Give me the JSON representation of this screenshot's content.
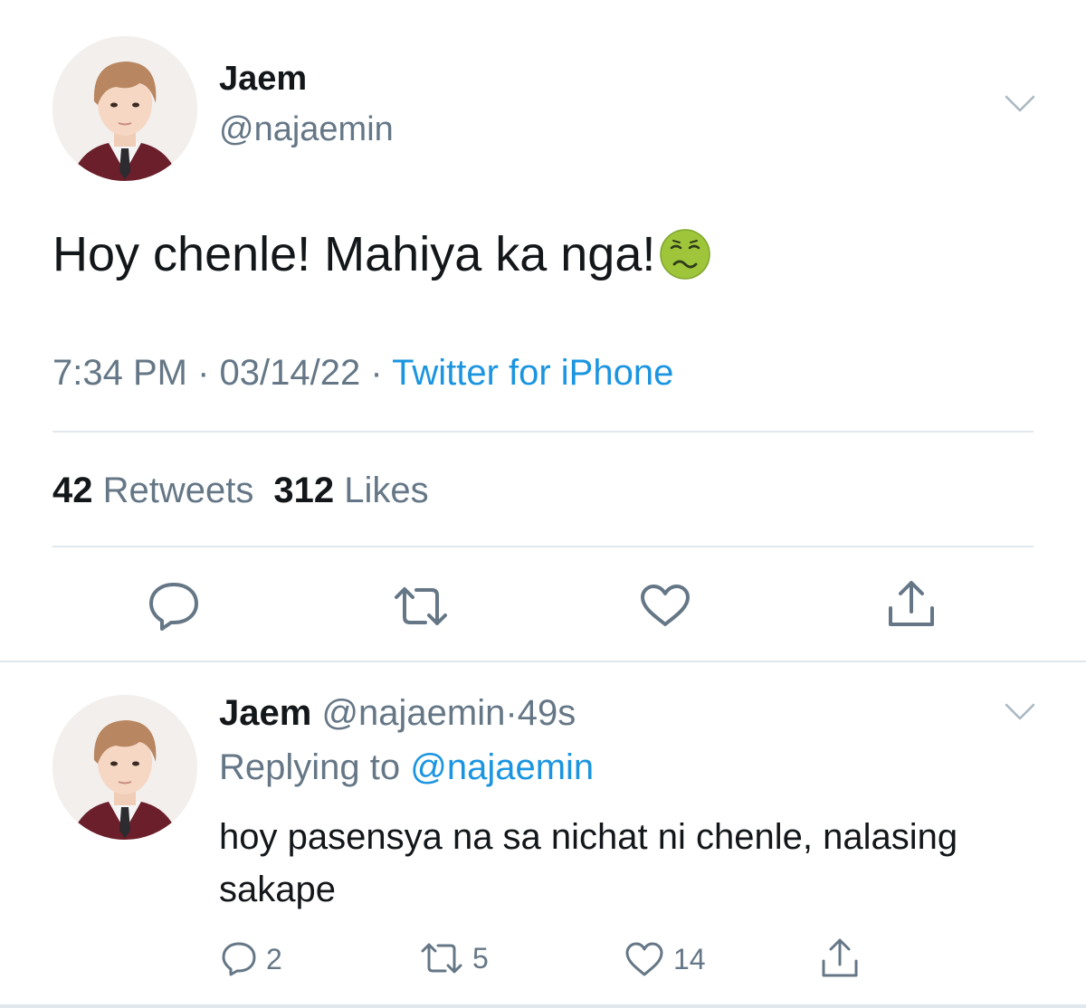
{
  "main_tweet": {
    "author_name": "Jaem",
    "author_handle": "@najaemin",
    "text": "Hoy chenle! Mahiya ka nga!",
    "emoji": "nauseated-face",
    "time": "7:34 PM",
    "date": "03/14/22",
    "separator": "·",
    "source": "Twitter for iPhone",
    "retweet_count": "42",
    "retweet_label": "Retweets",
    "like_count": "312",
    "like_label": "Likes"
  },
  "reply_tweet": {
    "author_name": "Jaem",
    "author_handle": "@najaemin",
    "separator": "·",
    "elapsed": "49s",
    "replying_label": "Replying to",
    "replying_handle": "@najaemin",
    "text": "hoy pasensya na sa nichat ni chenle, nalasing sakape",
    "reply_count": "2",
    "retweet_count": "5",
    "like_count": "14"
  },
  "icons": {
    "reply": "speech-bubble-icon",
    "retweet": "retweet-arrows-icon",
    "like": "heart-outline-icon",
    "share": "share-upload-icon",
    "more": "chevron-down-icon"
  },
  "colors": {
    "text_primary": "#14171a",
    "text_secondary": "#657786",
    "link": "#1b95e0",
    "divider": "#e1e8ed"
  }
}
